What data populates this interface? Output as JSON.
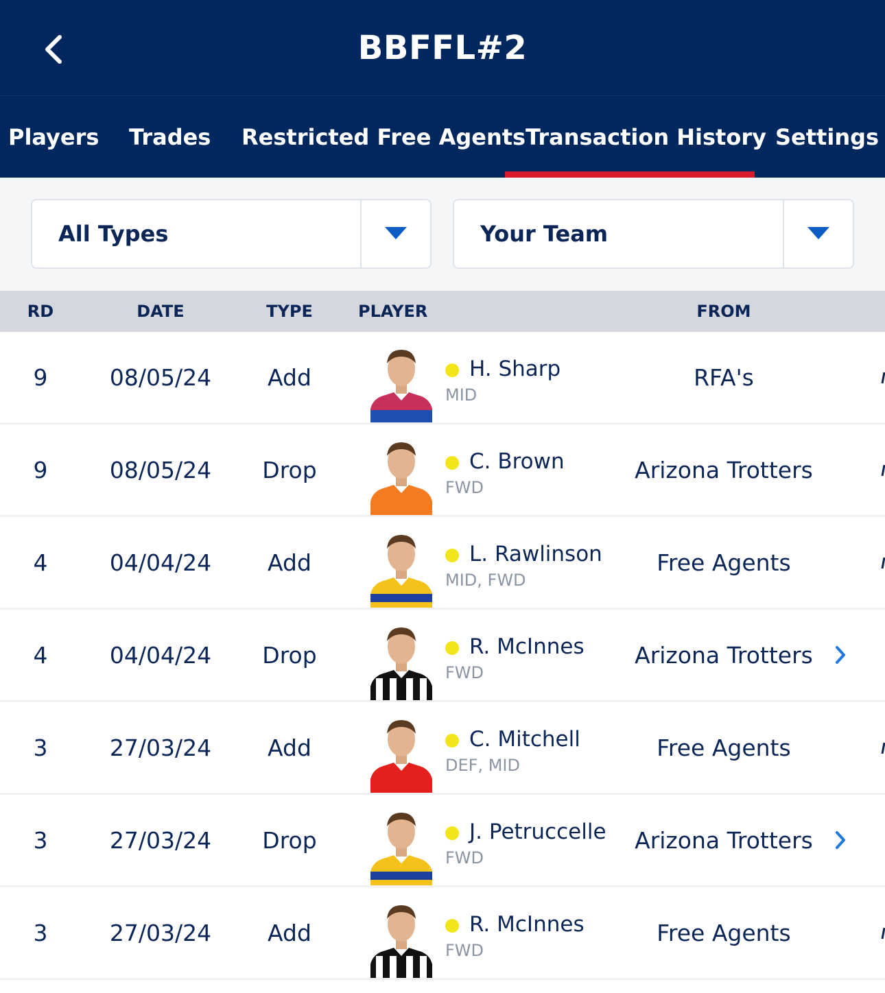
{
  "header": {
    "title": "BBFFL#2",
    "back_icon": "chevron-left-icon"
  },
  "tabs": [
    {
      "label": "Players"
    },
    {
      "label": "Trades"
    },
    {
      "label": "Restricted Free Agents"
    },
    {
      "label": "Transaction History",
      "active": true
    },
    {
      "label": "Settings"
    }
  ],
  "filters": {
    "type": {
      "value": "All Types"
    },
    "team": {
      "value": "Your Team"
    }
  },
  "table": {
    "columns": {
      "rd": "RD",
      "date": "DATE",
      "type": "TYPE",
      "player": "PLAYER",
      "from": "FROM"
    },
    "rows": [
      {
        "rd": "9",
        "date": "08/05/24",
        "type": "Add",
        "name": "H. Sharp",
        "pos": "MID",
        "from": "RFA's",
        "chevron": false,
        "guernsey": "lions"
      },
      {
        "rd": "9",
        "date": "08/05/24",
        "type": "Drop",
        "name": "C. Brown",
        "pos": "FWD",
        "from": "Arizona Trotters",
        "chevron": false,
        "guernsey": "giants"
      },
      {
        "rd": "4",
        "date": "04/04/24",
        "type": "Add",
        "name": "L. Rawlinson",
        "pos": "MID, FWD",
        "from": "Free Agents",
        "chevron": false,
        "guernsey": "eagles"
      },
      {
        "rd": "4",
        "date": "04/04/24",
        "type": "Drop",
        "name": "R. McInnes",
        "pos": "FWD",
        "from": "Arizona Trotters",
        "chevron": true,
        "guernsey": "magpies"
      },
      {
        "rd": "3",
        "date": "27/03/24",
        "type": "Add",
        "name": "C. Mitchell",
        "pos": "DEF, MID",
        "from": "Free Agents",
        "chevron": false,
        "guernsey": "swans"
      },
      {
        "rd": "3",
        "date": "27/03/24",
        "type": "Drop",
        "name": "J. Petruccelle",
        "pos": "FWD",
        "from": "Arizona Trotters",
        "chevron": true,
        "guernsey": "eagles"
      },
      {
        "rd": "3",
        "date": "27/03/24",
        "type": "Add",
        "name": "R. McInnes",
        "pos": "FWD",
        "from": "Free Agents",
        "chevron": false,
        "guernsey": "magpies"
      }
    ]
  },
  "colors": {
    "navy": "#00285e",
    "active_tab_underline": "#d91a2a",
    "status_dot": "#f2e51a",
    "link_blue": "#1f78e0"
  }
}
